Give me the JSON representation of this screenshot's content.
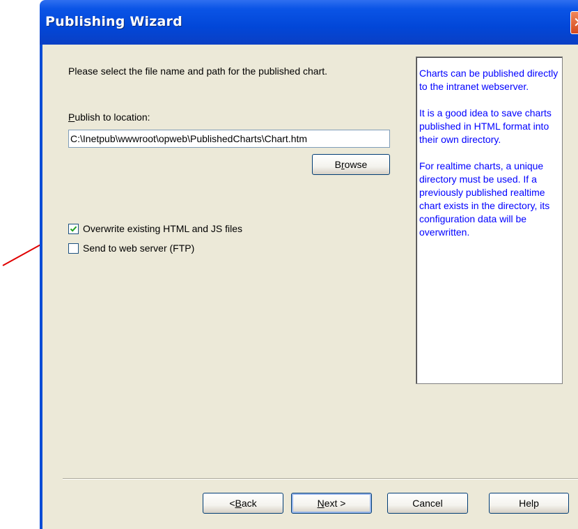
{
  "window": {
    "title": "Publishing Wizard",
    "close_glyph": "✕"
  },
  "content": {
    "instruction": "Please select the file name and path for the published chart.",
    "location_label": "Publish to location:",
    "location_label_underline": "P",
    "location_label_rest": "ublish to location:",
    "path_value": "C:\\Inetpub\\wwwroot\\opweb\\PublishedCharts\\Chart.htm",
    "browse_label_pre": "B",
    "browse_label_ul": "r",
    "browse_label_post": "owse",
    "checkboxes": [
      {
        "label": "Overwrite existing HTML and JS files",
        "checked": true
      },
      {
        "label": "Send to web server (FTP)",
        "checked": false
      }
    ]
  },
  "help_text": {
    "para1": "Charts can be published directly to the intranet webserver.",
    "para2": "It is a good idea to save charts published in HTML format into their own directory.",
    "para3": "For realtime charts, a unique directory must be used.  If a previously published realtime chart exists in the directory, its configuration data will be overwritten."
  },
  "footer": {
    "back_pre": "< ",
    "back_ul": "B",
    "back_post": "ack",
    "next_ul": "N",
    "next_post": "ext >",
    "cancel": "Cancel",
    "help": "Help"
  },
  "colors": {
    "accent": "#0a54e6",
    "help_text": "#0000ff",
    "annotation_arrow": "#e00000",
    "dialog_bg": "#ece9d8"
  },
  "icons": {
    "close": "close-icon",
    "check": "checkmark-icon",
    "annotation": "red-arrow-annotation"
  }
}
